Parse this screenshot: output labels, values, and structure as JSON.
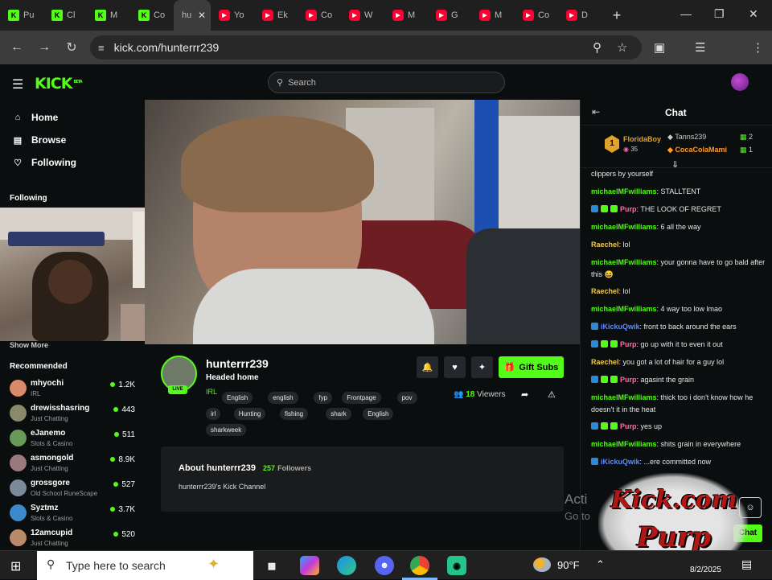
{
  "browser": {
    "tabs": [
      {
        "title": "Pu",
        "kind": "kick"
      },
      {
        "title": "Cl",
        "kind": "kick"
      },
      {
        "title": "M",
        "kind": "kick"
      },
      {
        "title": "Co",
        "kind": "kick"
      },
      {
        "title": "hu",
        "kind": "active"
      },
      {
        "title": "Yo",
        "kind": "yt"
      },
      {
        "title": "Ek",
        "kind": "yt"
      },
      {
        "title": "Co",
        "kind": "yt"
      },
      {
        "title": "W",
        "kind": "yt"
      },
      {
        "title": "M",
        "kind": "yt"
      },
      {
        "title": "G",
        "kind": "yt"
      },
      {
        "title": "M",
        "kind": "yt"
      },
      {
        "title": "Co",
        "kind": "yt"
      },
      {
        "title": "D",
        "kind": "yt"
      }
    ],
    "url": "kick.com/hunterrr239"
  },
  "kick": {
    "logo": "KICK",
    "logo_beta": "BETA",
    "search_placeholder": "Search"
  },
  "sidebar": {
    "nav": [
      {
        "label": "Home",
        "icon": "home-icon"
      },
      {
        "label": "Browse",
        "icon": "browse-icon"
      },
      {
        "label": "Following",
        "icon": "heart-icon"
      }
    ],
    "following_title": "Following",
    "show_more": "Show More",
    "recommended_title": "Recommended",
    "recommended": [
      {
        "name": "mhyochi",
        "category": "IRL",
        "viewers": "1.2K",
        "color": "#d98a6a"
      },
      {
        "name": "drewisshasring",
        "category": "Just Chatting",
        "viewers": "443",
        "color": "#8a8a6a"
      },
      {
        "name": "eJanemo",
        "category": "Slots & Casino",
        "viewers": "511",
        "color": "#6a9a5a"
      },
      {
        "name": "asmongold",
        "category": "Just Chatting",
        "viewers": "8.9K",
        "color": "#9a7a7a"
      },
      {
        "name": "grossgore",
        "category": "Old School RuneScape",
        "viewers": "527",
        "color": "#7a8a9a"
      },
      {
        "name": "Syztmz",
        "category": "Slots & Casino",
        "viewers": "3.7K",
        "color": "#3a8acc"
      },
      {
        "name": "12amcupid",
        "category": "Just Chatting",
        "viewers": "520",
        "color": "#b88a6a"
      }
    ]
  },
  "channel": {
    "name": "hunterrr239",
    "title": "Headed home",
    "live_badge": "LIVE",
    "category": "IRL",
    "tags_row1": [
      "English",
      "english",
      "fyp",
      "Frontpage",
      "pov"
    ],
    "tags_row2": [
      "irl",
      "Hunting",
      "fishing",
      "shark",
      "English"
    ],
    "tags_row3": [
      "sharkweek"
    ],
    "gift_label": "Gift Subs",
    "viewers": "18",
    "viewers_label": "Viewers",
    "about_title": "About hunterrr239",
    "followers": "257",
    "followers_label": "Followers",
    "about_text": "hunterrr239's Kick Channel"
  },
  "chat": {
    "title": "Chat",
    "leaderboard": [
      {
        "rank": "1",
        "name": "FloridaBoy",
        "count": "35"
      },
      {
        "name": "Tanns239",
        "count": "2"
      },
      {
        "name": "CocaColaMami",
        "count": "1"
      }
    ],
    "messages": [
      {
        "user": "",
        "text": "clippers by yourself",
        "color": "#fff",
        "badges": 0
      },
      {
        "user": "michaelMFwilliams",
        "text": ": STALLTENT",
        "color": "#53fc18",
        "badges": 0
      },
      {
        "user": "Purp",
        "text": ": THE LOOK OF REGRET",
        "color": "#ff6aa8",
        "badges": 3
      },
      {
        "user": "michaelMFwilliams",
        "text": ": 6 all the way",
        "color": "#53fc18",
        "badges": 0
      },
      {
        "user": "Raechel",
        "text": ": lol",
        "color": "#f2c94c",
        "badges": 0
      },
      {
        "user": "michaelMFwilliams",
        "text": ": your gonna have to go bald after this 😆",
        "color": "#53fc18",
        "badges": 0
      },
      {
        "user": "Raechel",
        "text": ": lol",
        "color": "#f2c94c",
        "badges": 0
      },
      {
        "user": "michaelMFwilliams",
        "text": ": 4 way too low lmao",
        "color": "#53fc18",
        "badges": 0
      },
      {
        "user": "iKickuQwik",
        "text": ": front to back around the ears",
        "color": "#5c8cff",
        "badges": 1
      },
      {
        "user": "Purp",
        "text": ": go up with it to even it out",
        "color": "#ff6aa8",
        "badges": 3
      },
      {
        "user": "Raechel",
        "text": ": you got a lot of hair for a guy lol",
        "color": "#f2c94c",
        "badges": 0
      },
      {
        "user": "Purp",
        "text": ": agasint the grain",
        "color": "#ff6aa8",
        "badges": 3
      },
      {
        "user": "michaelMFwilliams",
        "text": ": thick too i don't know how he doesn't it in the heat",
        "color": "#53fc18",
        "badges": 0
      },
      {
        "user": "Purp",
        "text": ": yes up",
        "color": "#ff6aa8",
        "badges": 3
      },
      {
        "user": "michaelMFwilliams",
        "text": ": shits grain in everywhere",
        "color": "#53fc18",
        "badges": 0
      },
      {
        "user": "iKickuQwik",
        "text": ": ...ere committed now",
        "color": "#5c8cff",
        "badges": 1
      }
    ],
    "chat_button": "Chat"
  },
  "overlay": {
    "activate_windows": "Acti",
    "activate_sub": "Go to",
    "watermark_line1": "Kick.com",
    "watermark_line2": "Purp"
  },
  "taskbar": {
    "search_placeholder": "Type here to search",
    "temperature": "90°F",
    "date": "8/2/2025"
  }
}
